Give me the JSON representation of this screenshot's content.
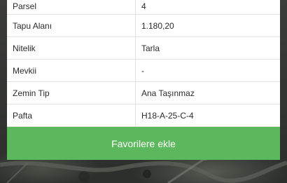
{
  "details": {
    "rows": [
      {
        "key": "Parsel",
        "value": "4"
      },
      {
        "key": "Tapu Alanı",
        "value": "1.180,20"
      },
      {
        "key": "Nitelik",
        "value": "Tarla"
      },
      {
        "key": "Mevkii",
        "value": "-"
      },
      {
        "key": "Zemin Tip",
        "value": "Ana Taşınmaz"
      },
      {
        "key": "Pafta",
        "value": "H18-A-25-C-4"
      }
    ]
  },
  "actions": {
    "favorite_label": "Favorilere ekle"
  },
  "colors": {
    "button_green": "#5cb85c",
    "card_bg": "#ffffff",
    "map_bg": "#2f3330"
  }
}
